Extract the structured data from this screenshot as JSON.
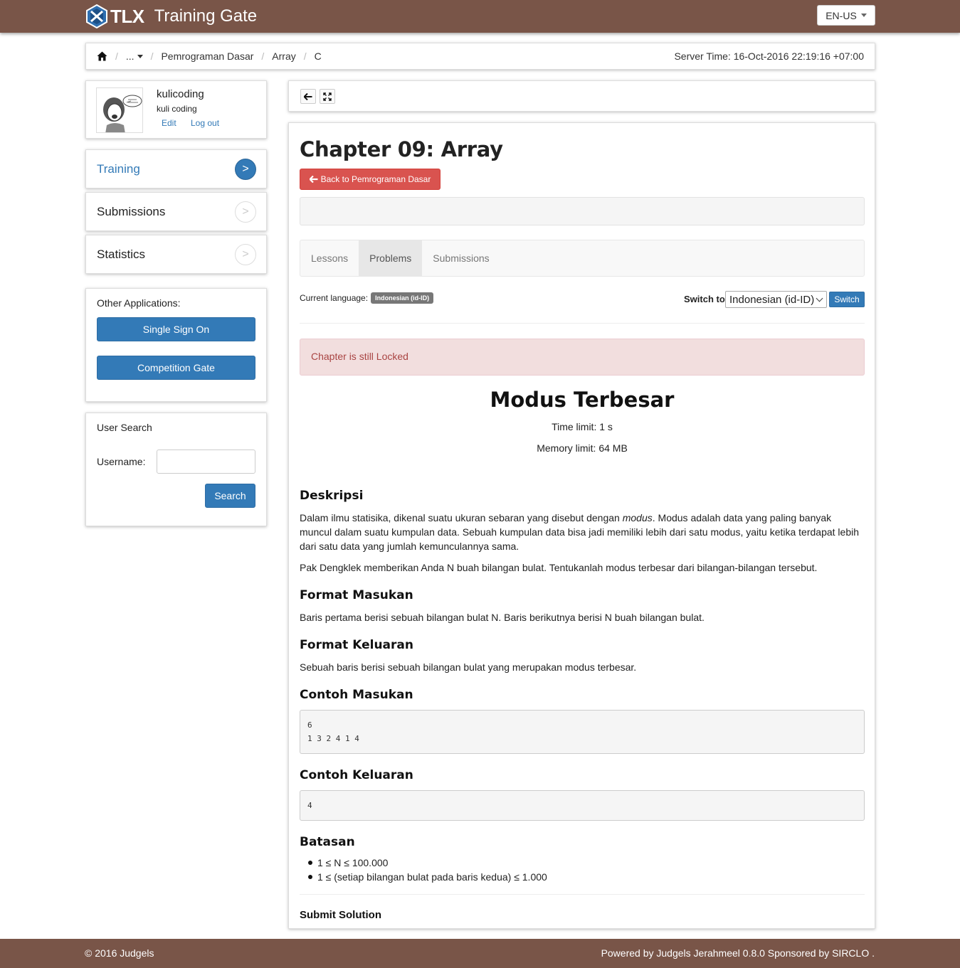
{
  "app": {
    "logo_text": "TLX",
    "name": "Training Gate",
    "language": "EN-US"
  },
  "breadcrumb": {
    "items": [
      "...",
      "Pemrograman Dasar",
      "Array",
      "C"
    ],
    "server_time": "Server Time: 16-Oct-2016 22:19:16 +07:00"
  },
  "profile": {
    "username": "kulicoding",
    "fullname": "kuli coding",
    "edit": "Edit",
    "logout": "Log out"
  },
  "sidebar": {
    "nav": [
      {
        "label": "Training",
        "active": true
      },
      {
        "label": "Submissions",
        "active": false
      },
      {
        "label": "Statistics",
        "active": false
      }
    ],
    "arrow": ">",
    "other_apps": {
      "title": "Other Applications:",
      "buttons": [
        "Single Sign On",
        "Competition Gate"
      ]
    },
    "user_search": {
      "title": "User Search",
      "label": "Username:",
      "value": "",
      "button": "Search"
    }
  },
  "chapter": {
    "title": "Chapter 09: Array",
    "back_button": "Back to Pemrograman Dasar",
    "tabs": [
      {
        "label": "Lessons",
        "active": false
      },
      {
        "label": "Problems",
        "active": true
      },
      {
        "label": "Submissions",
        "active": false
      }
    ],
    "current_language_label": "Current language:",
    "current_language": "Indonesian (id-ID)",
    "switch_label": "Switch to",
    "switch_selected": "Indonesian (id-ID)",
    "switch_button": "Switch",
    "alert": "Chapter is still Locked"
  },
  "problem": {
    "title": "Modus Terbesar",
    "time_limit": "Time limit: 1 s",
    "memory_limit": "Memory limit: 64 MB",
    "sections": {
      "deskripsi": {
        "heading": "Deskripsi",
        "p1_before": "Dalam ilmu statisika, dikenal suatu ukuran sebaran yang disebut dengan ",
        "p1_em": "modus",
        "p1_after": ". Modus adalah data yang paling banyak muncul dalam suatu kumpulan data. Sebuah kumpulan data bisa jadi memiliki lebih dari satu modus, yaitu ketika terdapat lebih dari satu data yang jumlah kemunculannya sama.",
        "p2": "Pak Dengklek memberikan Anda N buah bilangan bulat. Tentukanlah modus terbesar dari bilangan-bilangan tersebut."
      },
      "format_masukan": {
        "heading": "Format Masukan",
        "text": "Baris pertama berisi sebuah bilangan bulat N. Baris berikutnya berisi N buah bilangan bulat."
      },
      "format_keluaran": {
        "heading": "Format Keluaran",
        "text": "Sebuah baris berisi sebuah bilangan bulat yang merupakan modus terbesar."
      },
      "contoh_masukan": {
        "heading": "Contoh Masukan",
        "text": "6\n1 3 2 4 1 4"
      },
      "contoh_keluaran": {
        "heading": "Contoh Keluaran",
        "text": "4"
      },
      "batasan": {
        "heading": "Batasan",
        "items": [
          "1 ≤ N ≤ 100.000",
          "1 ≤ (setiap bilangan bulat pada baris kedua) ≤ 1.000"
        ]
      }
    },
    "submit_title": "Submit Solution"
  },
  "footer": {
    "left": "© 2016 Judgels",
    "right": "Powered by Judgels Jerahmeel 0.8.0 Sponsored by SIRCLO ."
  },
  "colors": {
    "brand": "#795548",
    "primary": "#337ab7",
    "danger": "#d9534f",
    "alert_bg": "#f2dede",
    "alert_text": "#a94442"
  },
  "icons": [
    "tlx-logo-icon",
    "home-icon",
    "caret-down-icon",
    "arrow-left-icon",
    "fullscreen-icon",
    "chevron-right-icon"
  ]
}
